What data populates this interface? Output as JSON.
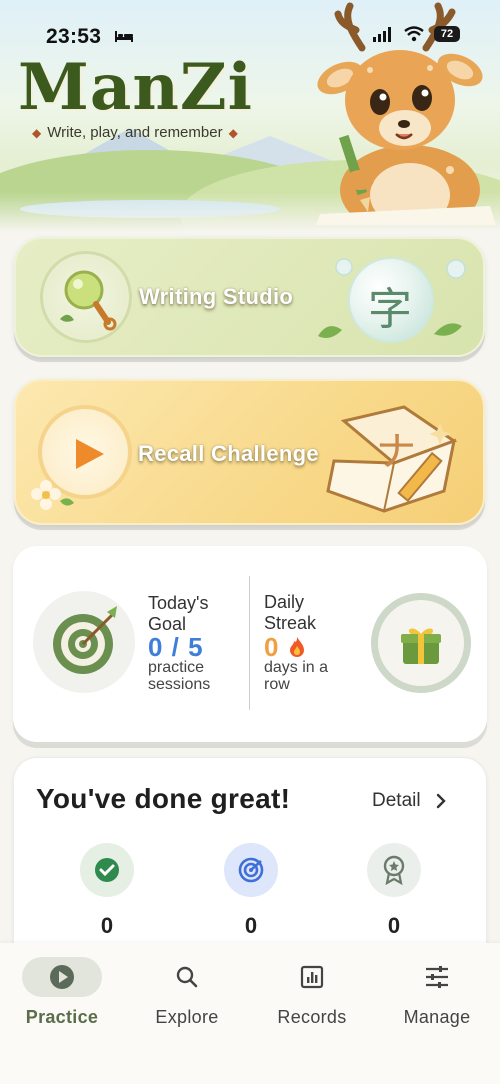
{
  "status_bar": {
    "time": "23:53",
    "battery": "72"
  },
  "header": {
    "logo": "ManZi",
    "tagline": "Write, play, and remember"
  },
  "cards": {
    "writing": {
      "title": "Writing Studio",
      "glyph": "字"
    },
    "recall": {
      "title": "Recall Challenge",
      "glyph": "ナ"
    }
  },
  "stats": {
    "goal_title": "Today's Goal",
    "goal_value": "0 / 5",
    "goal_sub": "practice sessions",
    "streak_title": "Daily Streak",
    "streak_value": "0",
    "streak_sub": "days in a row"
  },
  "summary": {
    "title": "You've done great!",
    "detail_label": "Detail",
    "metrics": [
      {
        "icon": "check-circle-icon",
        "value": "0",
        "color": "#2f8a4e"
      },
      {
        "icon": "radar-icon",
        "value": "0",
        "color": "#3f6fd9"
      },
      {
        "icon": "award-ribbon-icon",
        "value": "0",
        "color": "#6b7a6b"
      }
    ]
  },
  "nav": {
    "items": [
      {
        "label": "Practice",
        "icon": "play-circle-icon",
        "active": true
      },
      {
        "label": "Explore",
        "icon": "search-icon",
        "active": false
      },
      {
        "label": "Records",
        "icon": "bar-chart-icon",
        "active": false
      },
      {
        "label": "Manage",
        "icon": "sliders-icon",
        "active": false
      }
    ]
  },
  "colors": {
    "brand": "#3d5a1e",
    "goal_accent": "#3f7fd9",
    "streak_accent": "#f0a040",
    "active_nav": "#5a6e4a"
  }
}
